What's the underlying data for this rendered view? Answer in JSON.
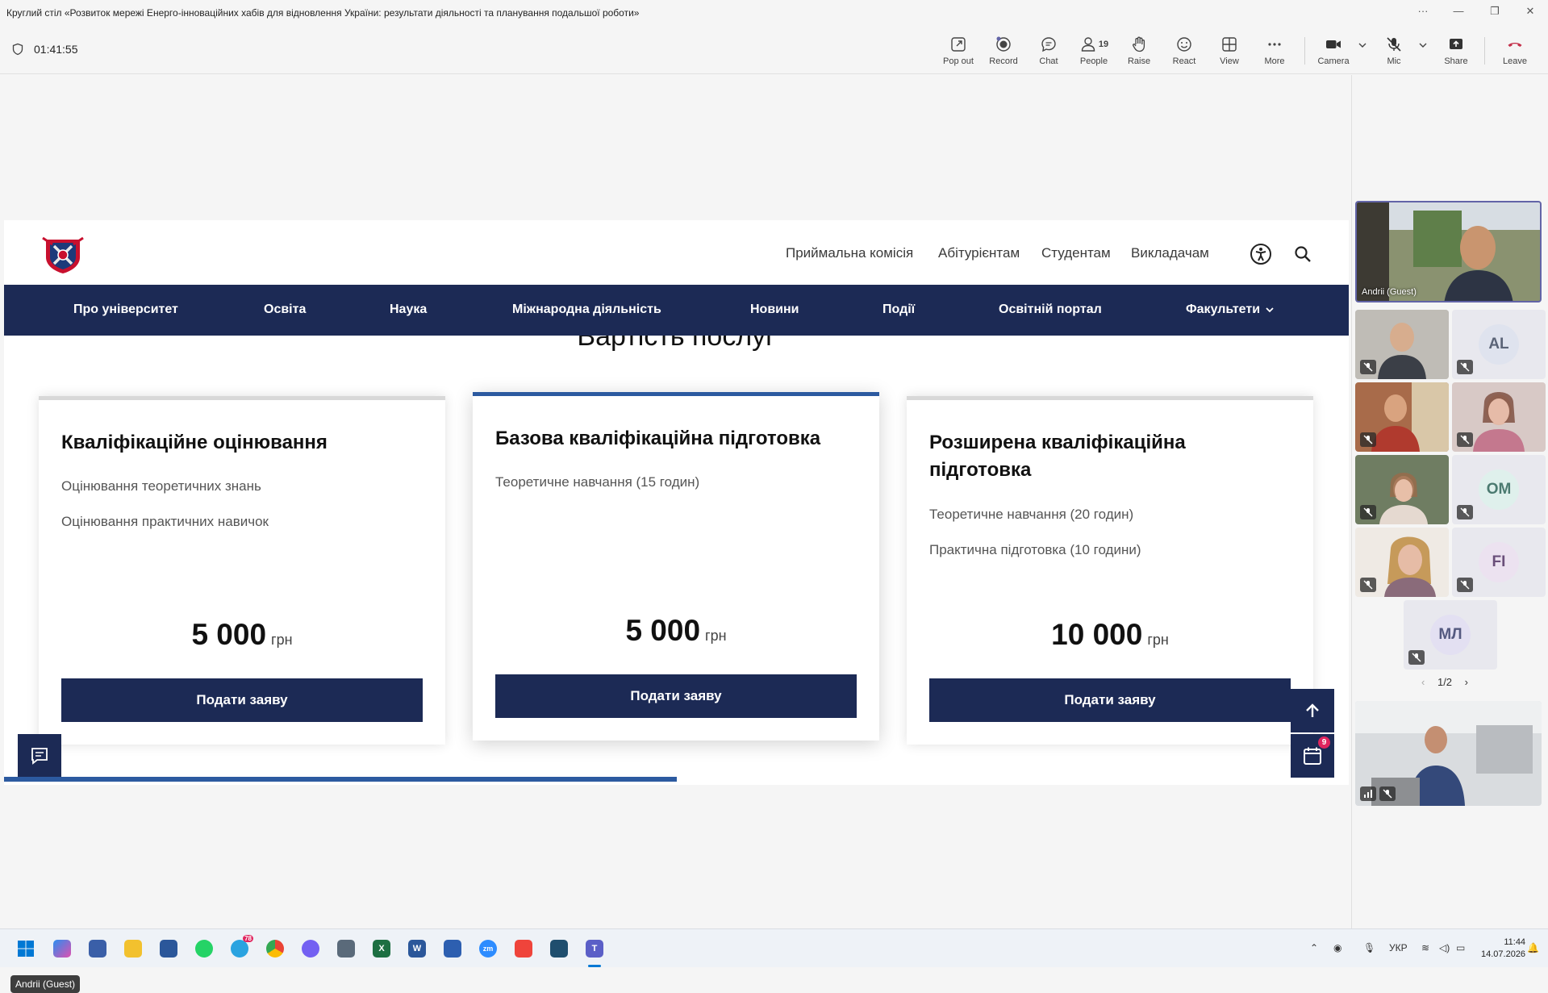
{
  "window": {
    "title": "Круглий стіл «Розвиток мережі Енерго-інноваційних хабів для відновлення України: результати діяльності та планування подальшої роботи»"
  },
  "toolbar": {
    "timer": "01:41:55",
    "buttons": {
      "popout": "Pop out",
      "record": "Record",
      "chat": "Chat",
      "people": "People",
      "people_count": "19",
      "raise": "Raise",
      "react": "React",
      "view": "View",
      "more": "More",
      "camera": "Camera",
      "mic": "Mic",
      "share": "Share",
      "leave": "Leave"
    }
  },
  "site": {
    "top_links": [
      "Приймальна комісія",
      "Абітурієнтам",
      "Студентам",
      "Викладачам"
    ],
    "main_nav": [
      "Про університет",
      "Освіта",
      "Наука",
      "Міжнародна діяльність",
      "Новини",
      "Події",
      "Освітній портал",
      "Факультети"
    ],
    "section_title": "Вартість послуг",
    "cards": [
      {
        "title": "Кваліфікаційне оцінювання",
        "features": [
          "Оцінювання теоретичних знань",
          "Оцінювання практичних навичок"
        ],
        "price": "5 000",
        "currency": "грн",
        "button": "Подати заяву"
      },
      {
        "title": "Базова кваліфікаційна підготовка",
        "features": [
          "Теоретичне навчання (15 годин)"
        ],
        "price": "5 000",
        "currency": "грн",
        "button": "Подати заяву"
      },
      {
        "title": "Розширена кваліфікаційна підготовка",
        "features": [
          "Теоретичне навчання (20 годин)",
          "Практична підготовка (10 години)"
        ],
        "price": "10 000",
        "currency": "грн",
        "button": "Подати заяву"
      }
    ],
    "calendar_badge": "9",
    "progress_fraction": 0.5
  },
  "presenter_tag": "Andrii (Guest)",
  "participants": {
    "active_speaker": "Andrii (Guest)",
    "initials": [
      "AL",
      "OM",
      "FI",
      "МЛ"
    ],
    "pager": "1/2"
  },
  "taskbar": {
    "telegram_badge": "78",
    "lang": "УКР",
    "time": "11:44",
    "date": "14.07.2026"
  },
  "colors": {
    "nav_bg": "#1c2a55",
    "accent": "#2c5aa0",
    "leave": "#c4314b"
  }
}
